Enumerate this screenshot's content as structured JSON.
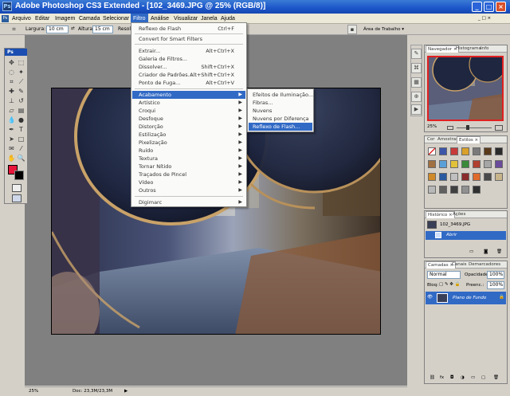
{
  "window": {
    "logo": "Ps",
    "title": "Adobe Photoshop CS3 Extended - [102_3469.JPG @ 25% (RGB/8)]",
    "min": "_",
    "max": "□",
    "close": "×"
  },
  "menubar": {
    "items": [
      {
        "label": "Arquivo"
      },
      {
        "label": "Editar"
      },
      {
        "label": "Imagem"
      },
      {
        "label": "Camada"
      },
      {
        "label": "Selecionar"
      },
      {
        "label": "Filtro"
      },
      {
        "label": "Análise"
      },
      {
        "label": "Visualizar"
      },
      {
        "label": "Janela"
      },
      {
        "label": "Ajuda"
      }
    ],
    "active_index": 5
  },
  "options_bar": {
    "width_label": "Largura:",
    "width_value": "10 cm",
    "height_label": "Altura:",
    "height_value": "15 cm",
    "resolution_label": "Resolução:",
    "workspace_label": "Área de Trabalho ▾"
  },
  "filter_menu": {
    "items": [
      {
        "label": "Reflexo de Flash",
        "shortcut": "Ctrl+F"
      },
      {
        "label": "Convert for Smart Filters",
        "shortcut": ""
      },
      {
        "label": "Extrair...",
        "shortcut": "Alt+Ctrl+X"
      },
      {
        "label": "Galeria de Filtros...",
        "shortcut": ""
      },
      {
        "label": "Dissolver...",
        "shortcut": "Shift+Ctrl+X"
      },
      {
        "label": "Criador de Padrões...",
        "shortcut": "Alt+Shift+Ctrl+X"
      },
      {
        "label": "Ponto de Fuga...",
        "shortcut": "Alt+Ctrl+V"
      },
      {
        "label": "Acabamento",
        "has_submenu": true
      },
      {
        "label": "Artístico",
        "has_submenu": true
      },
      {
        "label": "Croqui",
        "has_submenu": true
      },
      {
        "label": "Desfoque",
        "has_submenu": true
      },
      {
        "label": "Distorção",
        "has_submenu": true
      },
      {
        "label": "Estilização",
        "has_submenu": true
      },
      {
        "label": "Pixelização",
        "has_submenu": true
      },
      {
        "label": "Ruído",
        "has_submenu": true
      },
      {
        "label": "Textura",
        "has_submenu": true
      },
      {
        "label": "Tornar Nítido",
        "has_submenu": true
      },
      {
        "label": "Traçados de Pincel",
        "has_submenu": true
      },
      {
        "label": "Vídeo",
        "has_submenu": true
      },
      {
        "label": "Outros",
        "has_submenu": true
      },
      {
        "label": "Digimarc",
        "has_submenu": true
      }
    ],
    "active_label": "Acabamento"
  },
  "submenu": {
    "items": [
      {
        "label": "Efeitos de Iluminação..."
      },
      {
        "label": "Fibras..."
      },
      {
        "label": "Nuvens"
      },
      {
        "label": "Nuvens por Diferença"
      },
      {
        "label": "Reflexo de Flash..."
      }
    ],
    "active_label": "Reflexo de Flash..."
  },
  "toolbox": {
    "title": "Ps"
  },
  "navigator": {
    "tabs": [
      "Navegador ×",
      "Histograma",
      "Info"
    ],
    "zoom": "25%"
  },
  "swatches": {
    "tabs": [
      "Cor",
      "Amostras",
      "Estilos ×"
    ]
  },
  "history": {
    "tabs": [
      "Histórico ×",
      "Ações"
    ],
    "snapshot": "102_3469.JPG",
    "step": "Abrir"
  },
  "layers": {
    "tabs": [
      "Camadas ×",
      "Canais",
      "Demarcadores"
    ],
    "blend_mode": "Normal",
    "opacity_label": "Opacidade:",
    "opacity_value": "100%",
    "lock_label": "Bloq:",
    "fill_label": "Preenc.:",
    "fill_value": "100%",
    "layer_name": "Plano de Fundo"
  },
  "statusbar": {
    "zoom": "25%",
    "doc_info": "Doc: 23,3M/23,3M"
  },
  "colors": {
    "menu_highlight": "#316ac5",
    "foreground": "#e8163a",
    "background": "#000000"
  }
}
